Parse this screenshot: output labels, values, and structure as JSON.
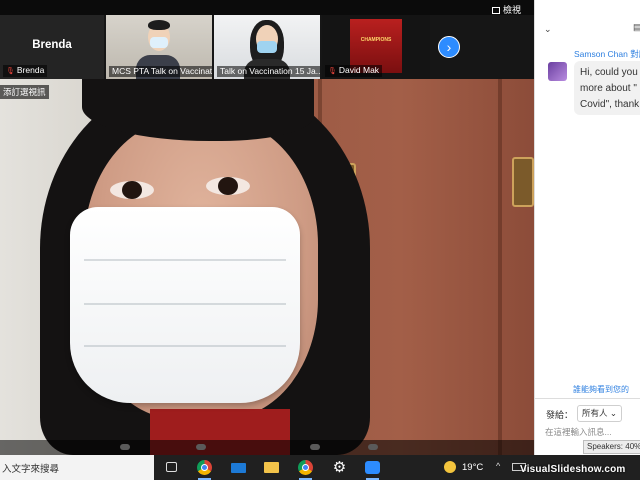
{
  "meeting": {
    "view_label": "檢視",
    "pin_label": "添訂選視訊",
    "thumbnails": [
      {
        "id": "brenda",
        "display_name": "Brenda",
        "label": "Brenda",
        "muted": true
      },
      {
        "id": "mcs",
        "label": "MCS PTA Talk on Vaccinat...",
        "muted": false
      },
      {
        "id": "talk",
        "label": "Talk on Vaccination 15 Ja...",
        "muted": false
      },
      {
        "id": "david",
        "label": "David Mak",
        "poster_text": "CHAMPIONS",
        "muted": true
      }
    ]
  },
  "chat": {
    "sender": "Samson Chan 對所",
    "message_lines": [
      "Hi, could you",
      "more about \"",
      "Covid\", thank"
    ],
    "visibility_note": "誰能夠看到您的",
    "send_to_label": "發給：",
    "send_to_value": "所有人",
    "input_placeholder": "在這裡輸入訊息..."
  },
  "taskbar": {
    "search_text": "入文字來搜尋",
    "temperature": "19°C",
    "speakers_tooltip": "Speakers: 40%"
  },
  "watermark": "VisualSlideshow.com",
  "colors": {
    "zoom_blue": "#2d8cff",
    "chat_link_blue": "#2d7fe0",
    "mute_red": "#e5433b"
  }
}
